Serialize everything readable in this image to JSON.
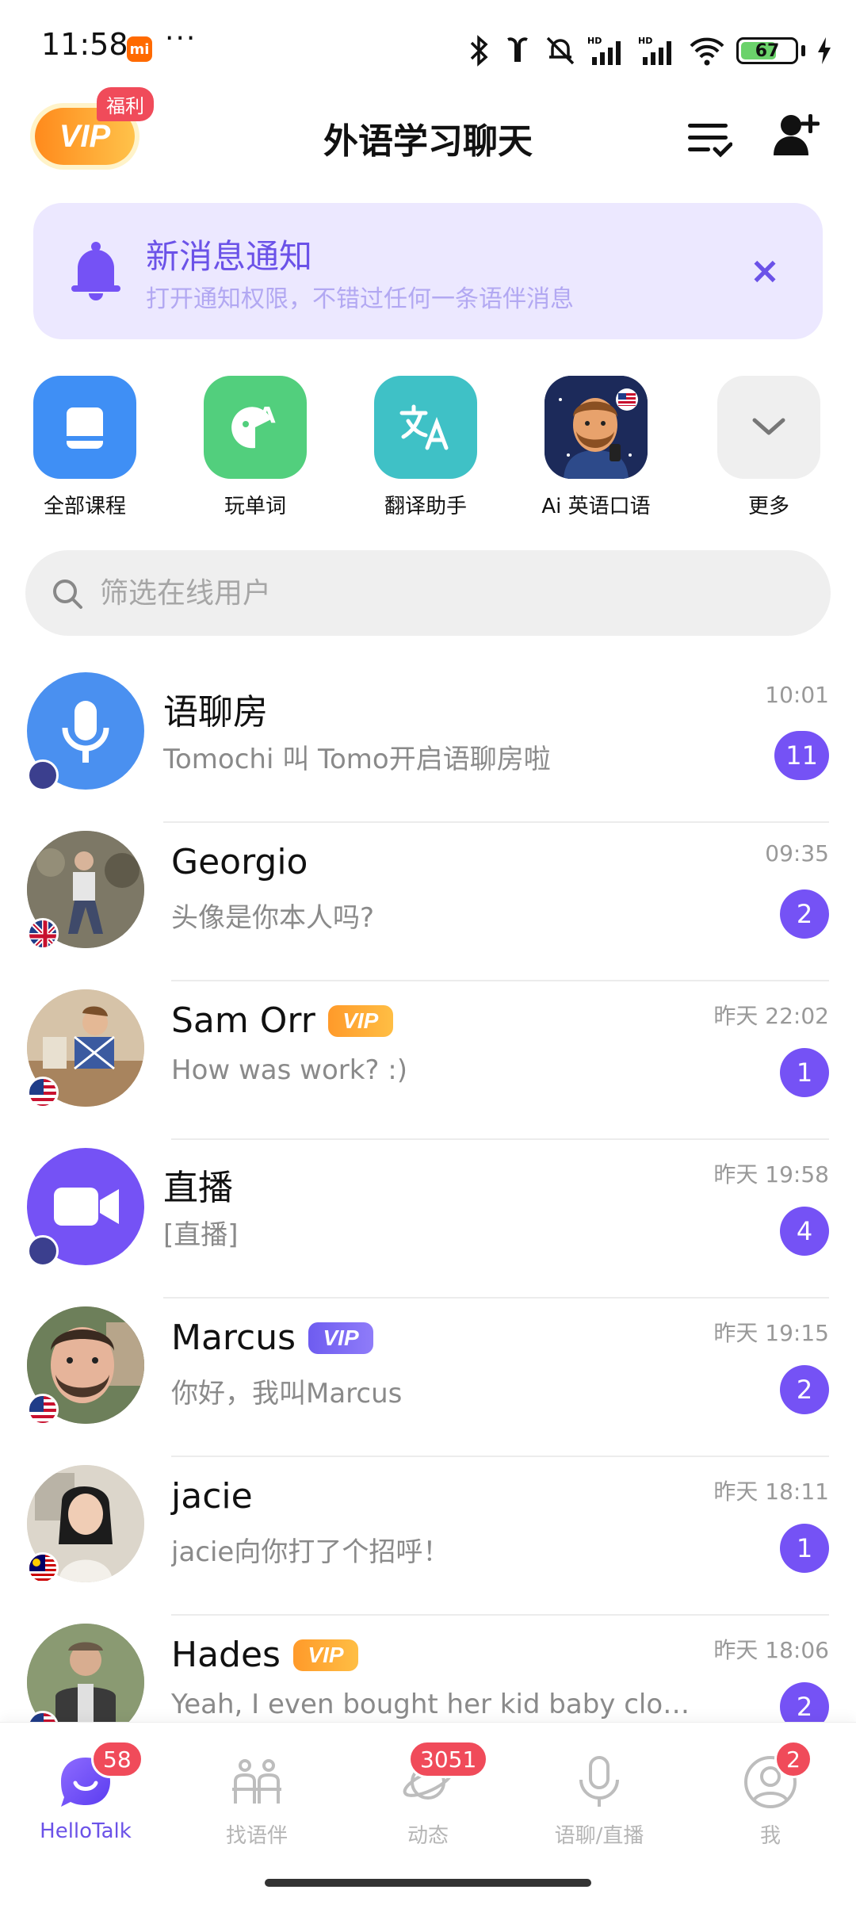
{
  "status_bar": {
    "time": "11:58",
    "mi_label": "mi",
    "dots": "···",
    "battery": "67"
  },
  "header": {
    "vip_label": "VIP",
    "fuli_tag": "福利",
    "title": "外语学习聊天"
  },
  "notification": {
    "title": "新消息通知",
    "subtitle": "打开通知权限，不错过任何一条语伴消息",
    "close_symbol": "×"
  },
  "quick_actions": [
    {
      "label": "全部课程",
      "color": "#3f8ff5"
    },
    {
      "label": "玩单词",
      "color": "#52cf7d"
    },
    {
      "label": "翻译助手",
      "color": "#3fc1c6"
    },
    {
      "label": "Ai 英语口语",
      "color": "#1c2a5a"
    },
    {
      "label": "更多",
      "color": "#efefef"
    }
  ],
  "search": {
    "placeholder": "筛选在线用户"
  },
  "conversations": [
    {
      "name": "语聊房",
      "message": "Tomochi 叫 Tomo开启语聊房啦",
      "time": "10:01",
      "unread": "11",
      "vip": "",
      "avatar": "mic-icon",
      "flag": "globe"
    },
    {
      "name": "Georgio",
      "message": "头像是你本人吗?",
      "time": "09:35",
      "unread": "2",
      "vip": "",
      "avatar": "photo",
      "flag": "uk"
    },
    {
      "name": "Sam Orr",
      "message": "How was work? :)",
      "time": "昨天 22:02",
      "unread": "1",
      "vip": "VIP",
      "vip_color": "gold",
      "avatar": "photo",
      "flag": "us"
    },
    {
      "name": "直播",
      "message": "[直播]",
      "time": "昨天 19:58",
      "unread": "4",
      "vip": "",
      "avatar": "video-icon",
      "flag": "globe"
    },
    {
      "name": "Marcus",
      "message": "你好，我叫Marcus",
      "time": "昨天 19:15",
      "unread": "2",
      "vip": "VIP",
      "vip_color": "purple",
      "avatar": "photo",
      "flag": "us"
    },
    {
      "name": "jacie",
      "message": "jacie向你打了个招呼！",
      "time": "昨天 18:11",
      "unread": "1",
      "vip": "",
      "avatar": "photo",
      "flag": "my"
    },
    {
      "name": "Hades",
      "message": "Yeah, I even bought her kid baby clo…",
      "time": "昨天 18:06",
      "unread": "2",
      "vip": "VIP",
      "vip_color": "gold",
      "avatar": "photo",
      "flag": "us"
    }
  ],
  "bottom_nav": [
    {
      "label": "HelloTalk",
      "badge": "58",
      "active": true
    },
    {
      "label": "找语伴",
      "badge": "",
      "active": false
    },
    {
      "label": "动态",
      "badge": "3051",
      "active": false
    },
    {
      "label": "语聊/直播",
      "badge": "",
      "active": false
    },
    {
      "label": "我",
      "badge": "2",
      "active": false
    }
  ],
  "colors": {
    "accent": "#7552f5",
    "badge_red": "#f04b5a",
    "notif_bg": "#ece8ff"
  }
}
